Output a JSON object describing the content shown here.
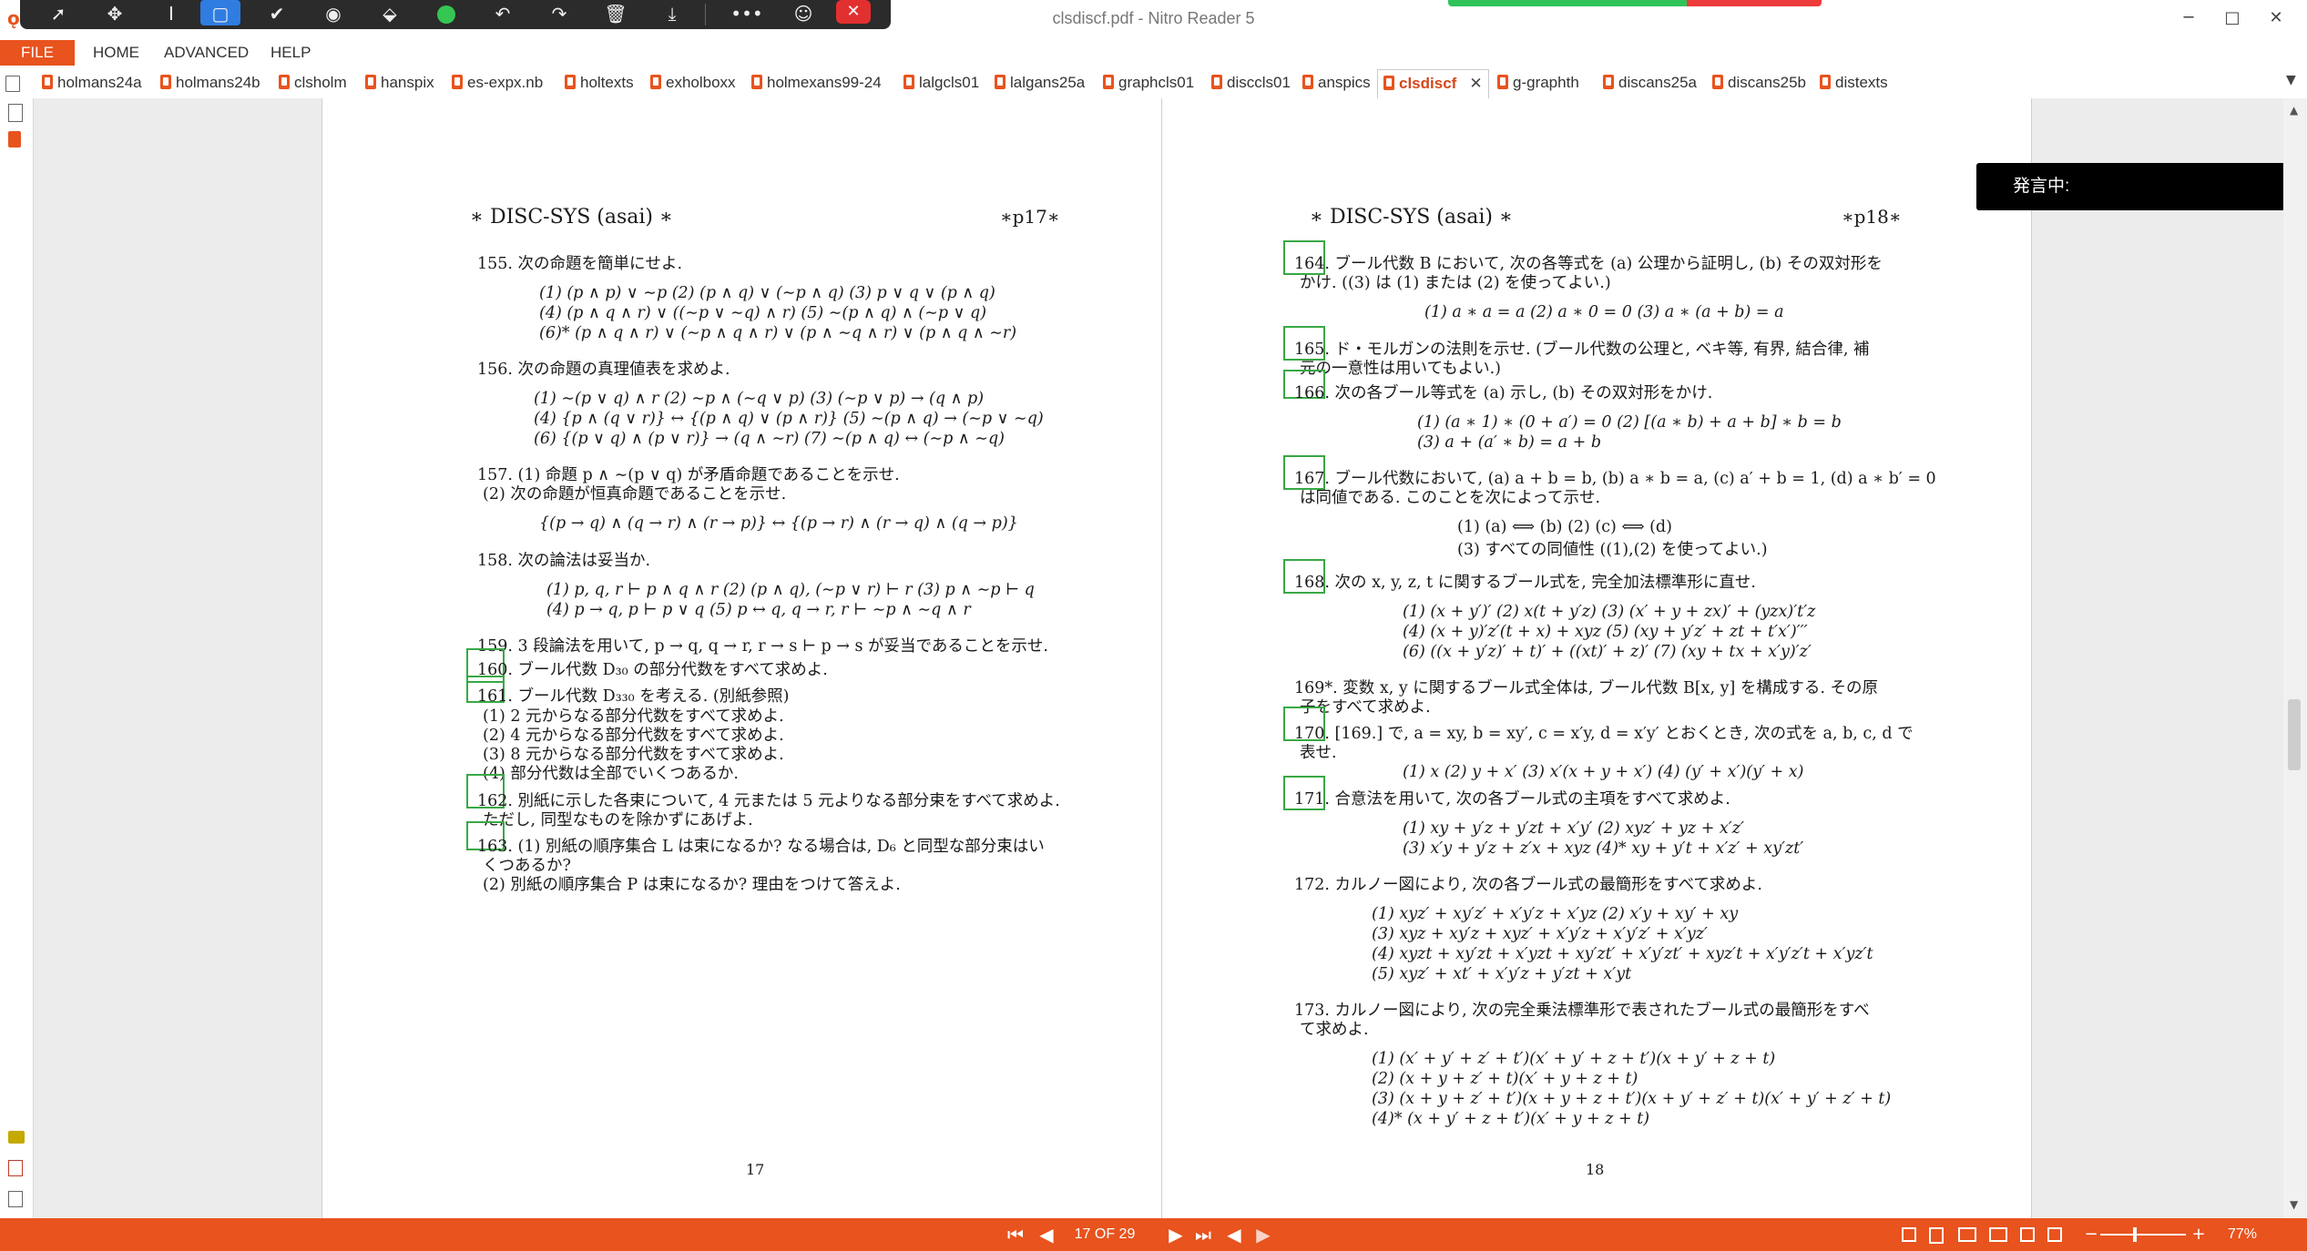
{
  "window": {
    "title": "clsdiscf.pdf - Nitro Reader 5",
    "minimize": "─",
    "maximize": "□",
    "close": "✕"
  },
  "float_toolbar": {
    "tools": [
      "select-arrow-icon",
      "pan-icon",
      "text-cursor-icon",
      "rectangle-select-icon",
      "checkmark-icon",
      "stamp-icon",
      "eraser-icon",
      "green-circle-icon",
      "undo-icon",
      "redo-icon",
      "trash-icon",
      "download-icon"
    ],
    "more": "•••",
    "close": "✕"
  },
  "ribbon": {
    "tabs": [
      "FILE",
      "HOME",
      "ADVANCED",
      "HELP"
    ]
  },
  "doc_tabs": [
    "holmans24a",
    "holmans24b",
    "clsholm",
    "hanspix",
    "es-expx.nb",
    "holtexts",
    "exholboxx",
    "holmexans99-24",
    "lalgcls01",
    "lalgans25a",
    "graphcls01",
    "disccls01",
    "anspics",
    "clsdiscf",
    "g-graphth",
    "discans25a",
    "discans25b",
    "distexts"
  ],
  "active_tab": "clsdiscf",
  "speech_panel": "発言中:",
  "page17": {
    "header_left": "∗ DISC-SYS (asai) ∗",
    "header_right": "∗p17∗",
    "lines": [
      "155. 次の命題を簡単にせよ.",
      "(1) (p ∧ p) ∨ ∼p    (2) (p ∧ q) ∨ (∼p ∧ q)    (3) p ∨ q ∨ (p ∧ q)",
      "(4) (p ∧ q ∧ r) ∨ ((∼p ∨ ∼q) ∧ r)    (5) ∼(p ∧ q) ∧ (∼p ∨ q)",
      "(6)* (p ∧ q ∧ r) ∨ (∼p ∧ q ∧ r) ∨ (p ∧ ∼q ∧ r) ∨ (p ∧ q ∧ ∼r)",
      "156. 次の命題の真理値表を求めよ.",
      "(1) ∼(p ∨ q) ∧ r    (2) ∼p ∧ (∼q ∨ p)    (3) (∼p ∨ p) → (q ∧ p)",
      "(4) {p ∧ (q ∨ r)} ↔ {(p ∧ q) ∨ (p ∧ r)}    (5) ∼(p ∧ q) → (∼p ∨ ∼q)",
      "(6) {(p ∨ q) ∧ (p ∨ r)} → (q ∧ ∼r)    (7) ∼(p ∧ q) ↔ (∼p ∧ ∼q)",
      "157. (1) 命題 p ∧ ∼(p ∨ q) が矛盾命題であることを示せ.",
      "(2) 次の命題が恒真命題であることを示せ.",
      "{(p → q) ∧ (q → r) ∧ (r → p)} ↔ {(p → r) ∧ (r → q) ∧ (q → p)}",
      "158. 次の論法は妥当か.",
      "(1) p, q, r ⊢ p ∧ q ∧ r    (2) (p ∧ q), (∼p ∨ r) ⊢ r    (3) p ∧ ∼p ⊢ q",
      "(4) p → q, p ⊢ p ∨ q       (5) p ↔ q, q → r, r ⊢ ∼p ∧ ∼q ∧ r",
      "159. 3 段論法を用いて, p → q, q → r, r → s ⊢ p → s が妥当であることを示せ.",
      "160. ブール代数 D₃₀ の部分代数をすべて求めよ.",
      "161. ブール代数 D₃₃₀ を考える. (別紙参照)",
      "(1) 2 元からなる部分代数をすべて求めよ.",
      "(2) 4 元からなる部分代数をすべて求めよ.",
      "(3) 8 元からなる部分代数をすべて求めよ.",
      "(4) 部分代数は全部でいくつあるか.",
      "162. 別紙に示した各束について, 4 元または 5 元よりなる部分束をすべて求めよ.",
      "ただし, 同型なものを除かずにあげよ.",
      "163. (1) 別紙の順序集合 L は束になるか? なる場合は, D₆ と同型な部分束はい",
      "くつあるか?",
      "(2) 別紙の順序集合 P は束になるか? 理由をつけて答えよ."
    ],
    "page_number": "17"
  },
  "page18": {
    "header_left": "∗ DISC-SYS (asai) ∗",
    "header_right": "∗p18∗",
    "lines": [
      "164. ブール代数 B において, 次の各等式を (a) 公理から証明し, (b) その双対形を",
      "かけ. ((3) は (1) または (2) を使ってよい.)",
      "(1) a ∗ a = a       (2) a ∗ 0 = 0       (3) a ∗ (a + b) = a",
      "165. ド・モルガンの法則を示せ. (ブール代数の公理と, ベキ等, 有界, 結合律, 補",
      "元の一意性は用いてもよい.)",
      "166. 次の各ブール等式を (a) 示し, (b) その双対形をかけ.",
      "(1) (a ∗ 1) ∗ (0 + a′) = 0       (2) [(a ∗ b) + a + b] ∗ b = b",
      "(3) a + (a′ ∗ b) = a + b",
      "167. ブール代数において, (a) a + b = b, (b) a ∗ b = a, (c) a′ + b = 1, (d) a ∗ b′ = 0",
      "は同値である. このことを次によって示せ.",
      "(1) (a) ⟺ (b)       (2) (c) ⟺ (d)",
      "(3) すべての同値性 ((1),(2) を使ってよい.)",
      "168. 次の x, y, z, t に関するブール式を, 完全加法標準形に直せ.",
      "(1) (x + y′)′    (2) x(t + y′z)    (3) (x′ + y + zx)′ + (yzx)′t′z",
      "(4) (x + y)′z′(t + x) + xyz        (5) (xy + y′z′ + zt + t′x′)′′′",
      "(6) ((x + y′z)′ + t)′ + ((xt)′ + z)′       (7) (xy + tx + x′y)′z′",
      "169*. 変数 x, y に関するブール式全体は, ブール代数 B[x, y] を構成する. その原",
      "子をすべて求めよ.",
      "170. [169.] で, a = xy, b = xy′, c = x′y, d = x′y′ とおくとき, 次の式を a, b, c, d で",
      "表せ.",
      "(1) x    (2) y + x′    (3) x′(x + y + x′)    (4) (y′ + x′)(y′ + x)",
      "171. 合意法を用いて, 次の各ブール式の主項をすべて求めよ.",
      "(1) xy + y′z + y′zt + x′y′          (2) xyz′ + yz + x′z′",
      "(3) x′y + y′z + z′x + xyz           (4)* xy + y′t + x′z′ + xy′zt′",
      "172. カルノー図により, 次の各ブール式の最簡形をすべて求めよ.",
      "(1) xyz′ + xy′z′ + x′y′z + x′yz        (2) x′y + xy′ + xy",
      "(3) xyz + xy′z + xyz′ + x′y′z + x′y′z′ + x′yz′",
      "(4) xyzt + xy′zt + x′yzt + xy′zt′ + x′y′zt′ + xyz′t + x′y′z′t + x′yz′t",
      "(5) xyz′ + xt′ + x′y′z + y′zt + x′yt",
      "173. カルノー図により, 次の完全乗法標準形で表されたブール式の最簡形をすべ",
      "て求めよ.",
      "(1) (x′ + y′ + z′ + t′)(x′ + y′ + z + t′)(x + y′ + z + t)",
      "(2) (x + y + z′ + t)(x′ + y + z + t)",
      "(3) (x + y + z′ + t′)(x + y + z + t′)(x + y′ + z′ + t)(x′ + y′ + z′ + t)",
      "(4)* (x + y′ + z + t′)(x′ + y + z + t)"
    ],
    "page_number": "18"
  },
  "statusbar": {
    "page_indicator": "17 OF 29",
    "zoom": "77%",
    "zoom_minus": "−",
    "zoom_plus": "+"
  }
}
